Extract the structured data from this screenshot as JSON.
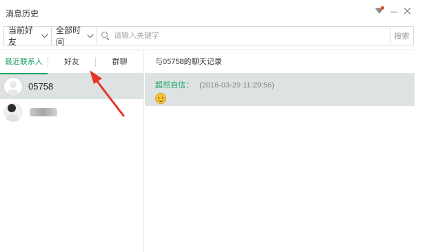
{
  "window": {
    "title": "消息历史"
  },
  "toolbar": {
    "friend_filter": "当前好友",
    "time_filter": "全部时间",
    "search_placeholder": "请输入关键字",
    "search_button": "搜索"
  },
  "sidebar": {
    "tabs": [
      {
        "label": "最近联系人",
        "active": true
      },
      {
        "label": "好友",
        "active": false
      },
      {
        "label": "群聊",
        "active": false
      }
    ],
    "contacts": [
      {
        "name": "05758",
        "selected": true
      },
      {
        "name": "",
        "selected": false
      }
    ]
  },
  "chat": {
    "header": "与05758的聊天记录",
    "messages": [
      {
        "sender": "超然自信：",
        "time": "(2016-03-29 11:29:56)",
        "content_icon": "smiley-emoji"
      }
    ]
  },
  "colors": {
    "accent": "#20a464",
    "selected_bg": "#dde3e3",
    "annotation_arrow": "#e8342a"
  }
}
